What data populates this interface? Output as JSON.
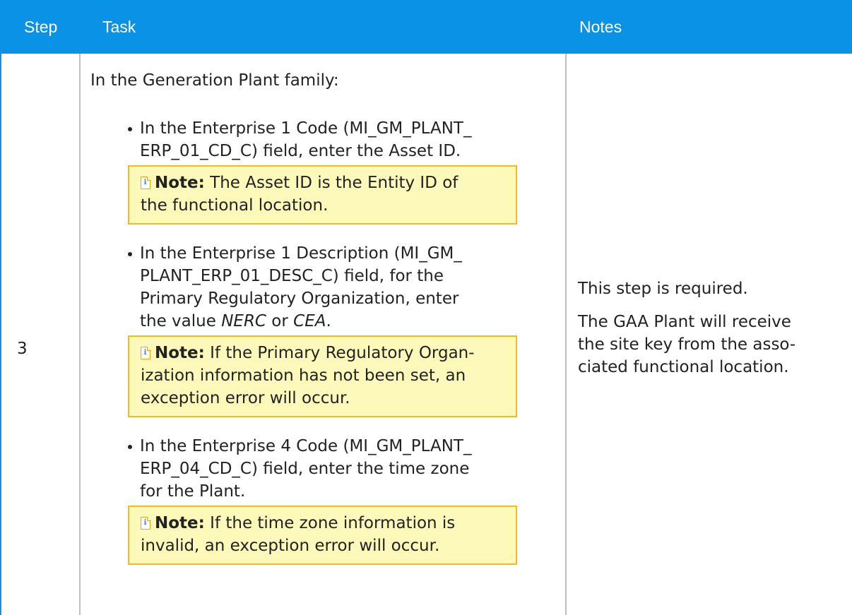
{
  "header": {
    "step": "Step",
    "task": "Task",
    "notes": "Notes"
  },
  "colors": {
    "header_bg": "#0a92e6",
    "header_text": "#ffffff",
    "note_bg": "#fcf9bb",
    "note_border": "#f6bb16",
    "row_border": "#bfbfbf"
  },
  "row": {
    "step": "3",
    "task": {
      "intro": "In the Generation Plant family:",
      "items": [
        {
          "lines": [
            "In the Enterprise 1 Code (MI_GM_PLANT_",
            "ERP_01_CD_C) field, enter the Asset ID."
          ],
          "note": {
            "icon": "note-info-icon",
            "label": "Note:",
            "lines": [
              " The Asset ID is the Entity ID of",
              "the functional location."
            ]
          }
        },
        {
          "lines": [
            "In the Enterprise 1 Description (MI_GM_",
            "PLANT_ERP_01_DESC_C) field, for the",
            "Primary Regulatory Organization, enter"
          ],
          "last_line_prefix": "the value ",
          "value_1": "NERC",
          "value_connector": " or ",
          "value_2": "CEA",
          "last_line_suffix": ".",
          "note": {
            "icon": "note-info-icon",
            "label": "Note:",
            "lines": [
              " If the Primary Regulatory Organ-",
              "ization information has not been set, an",
              "exception error will occur."
            ]
          }
        },
        {
          "lines": [
            "In the Enterprise 4 Code (MI_GM_PLANT_",
            "ERP_04_CD_C) field, enter the time zone",
            "for the Plant."
          ],
          "note": {
            "icon": "note-info-icon",
            "label": "Note:",
            "lines": [
              " If the time zone information is",
              "invalid, an exception error will occur."
            ]
          }
        }
      ]
    },
    "notes": {
      "p1": "This step is required.",
      "p2_lines": [
        "The GAA Plant will receive",
        "the site key from the asso-",
        "ciated functional location."
      ]
    }
  }
}
